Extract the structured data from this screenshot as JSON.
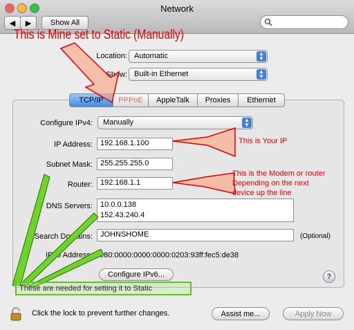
{
  "window": {
    "title": "Network",
    "show_all": "Show All"
  },
  "annotations": {
    "top": "This is Mine set to Static (Manually)",
    "ip": "This is Your IP",
    "router_line1": "This is the Modem or router",
    "router_line2": "Depending on the next",
    "router_line3": "device up the line",
    "bottom": "These are needed for setting it to Static"
  },
  "location": {
    "label": "Location:",
    "value": "Automatic"
  },
  "show": {
    "label": "Show:",
    "value": "Built-in Ethernet"
  },
  "tabs": [
    {
      "label": "TCP/IP"
    },
    {
      "label": "PPPoE"
    },
    {
      "label": "AppleTalk"
    },
    {
      "label": "Proxies"
    },
    {
      "label": "Ethernet"
    }
  ],
  "form": {
    "configure": {
      "label": "Configure IPv4:",
      "value": "Manually"
    },
    "ip": {
      "label": "IP Address:",
      "value": "192.168.1.100"
    },
    "subnet": {
      "label": "Subnet Mask:",
      "value": "255.255.255.0"
    },
    "router": {
      "label": "Router:",
      "value": "192.168.1.1"
    },
    "dns": {
      "label": "DNS Servers:",
      "values": [
        "10.0.0.138",
        "152.43.240.4"
      ]
    },
    "search": {
      "label": "Search Domains:",
      "value": "JOHNSHOME",
      "hint": "(Optional)"
    },
    "ipv6": {
      "label": "IPv6 Address:",
      "value": "fe80:0000:0000:0000:0203:93ff:fec5:de38"
    },
    "configure_ipv6": "Configure IPv6..."
  },
  "footer": {
    "lock_text": "Click the lock to prevent further changes.",
    "assist": "Assist me...",
    "apply": "Apply Now",
    "help": "?"
  },
  "colors": {
    "annotation_red": "#e00000",
    "arrow_fill": "#ff9a73",
    "green_arrow": "#6fd42a",
    "selected_tab": "#3f8ae6"
  }
}
